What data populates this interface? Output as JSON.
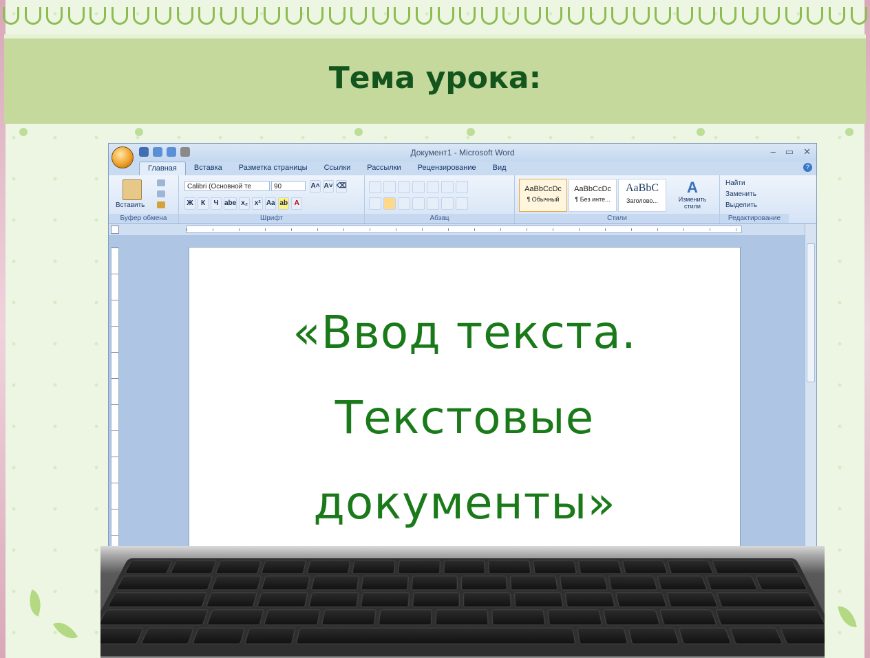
{
  "slide": {
    "title": "Тема урока:",
    "accent_color": "#14551e",
    "band_color": "#c5d99d"
  },
  "word": {
    "window_title": "Документ1 - Microsoft Word",
    "tabs": [
      "Главная",
      "Вставка",
      "Разметка страницы",
      "Ссылки",
      "Рассылки",
      "Рецензирование",
      "Вид"
    ],
    "active_tab": "Главная",
    "clipboard": {
      "paste_label": "Вставить",
      "group_label": "Буфер обмена"
    },
    "font": {
      "font_name": "Calibri (Основной те",
      "font_size": "90",
      "bold": "Ж",
      "italic": "К",
      "underline": "Ч",
      "strike": "abe",
      "subscript": "x₂",
      "superscript": "x²",
      "case": "Aa",
      "grow": "A˄",
      "shrink": "A˅",
      "group_label": "Шрифт"
    },
    "paragraph": {
      "group_label": "Абзац"
    },
    "styles": {
      "items": [
        {
          "sample": "AaBbCcDc",
          "name": "¶ Обычный"
        },
        {
          "sample": "AaBbCcDc",
          "name": "¶ Без инте..."
        },
        {
          "sample": "AaBbC",
          "name": "Заголово..."
        }
      ],
      "change_styles": "Изменить стили",
      "group_label": "Стили"
    },
    "editing": {
      "find": "Найти",
      "replace": "Заменить",
      "select": "Выделить",
      "group_label": "Редактирование"
    },
    "document_lines": [
      "«Ввод  текста.",
      "Текстовые",
      "документы»"
    ],
    "document_text_color": "#1a7a1a"
  }
}
